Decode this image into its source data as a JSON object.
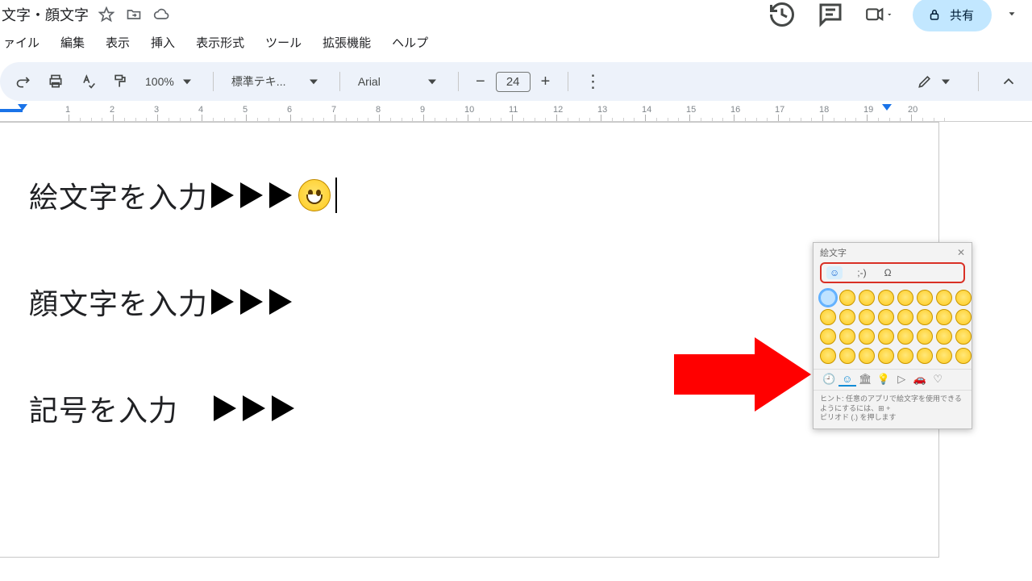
{
  "titlebar": {
    "doc_title": "文字・顔文字",
    "share_label": "共有"
  },
  "menu": {
    "file": "ァイル",
    "edit": "編集",
    "view": "表示",
    "insert": "挿入",
    "format": "表示形式",
    "tools": "ツール",
    "extensions": "拡張機能",
    "help": "ヘルプ"
  },
  "toolbar": {
    "zoom": "100%",
    "styles_label": "標準テキ...",
    "font_name": "Arial",
    "font_size": "24"
  },
  "ruler": {
    "start": 1,
    "end": 20
  },
  "document": {
    "line1_text": "絵文字を入力",
    "line2_text": "顔文字を入力",
    "line3_text": "記号を入力"
  },
  "picker": {
    "title": "絵文字",
    "tab_emoji": "☺",
    "tab_kaomoji": ";-)",
    "tab_symbol": "Ω",
    "hint_line1": "ヒント: 任意のアプリで絵文字を使用できるようにするには、⊞ +",
    "hint_line2": "ピリオド (.) を押します",
    "category_icons": [
      "🕘",
      "☺",
      "🏛",
      "💡",
      "▷",
      "🚗",
      "♡",
      ""
    ]
  }
}
